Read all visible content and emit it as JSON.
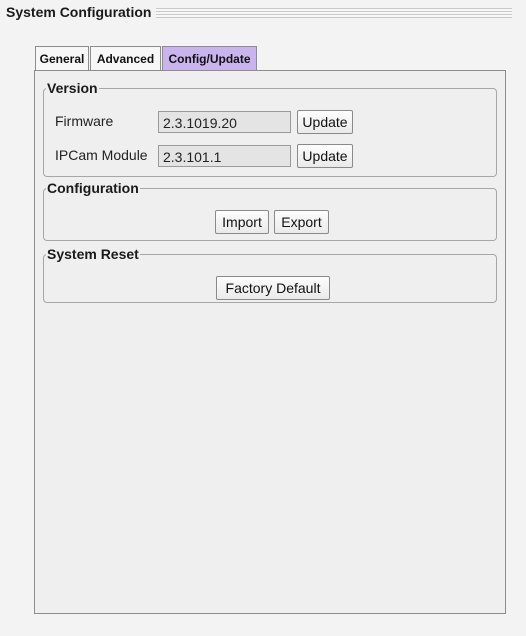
{
  "window": {
    "title": "System Configuration"
  },
  "tabs": [
    {
      "label": "General",
      "active": false
    },
    {
      "label": "Advanced",
      "active": false
    },
    {
      "label": "Config/Update",
      "active": true
    }
  ],
  "version": {
    "legend": "Version",
    "firmware_label": "Firmware",
    "firmware_value": "2.3.1019.20",
    "firmware_update": "Update",
    "ipcam_label": "IPCam Module",
    "ipcam_value": "2.3.101.1",
    "ipcam_update": "Update"
  },
  "configuration": {
    "legend": "Configuration",
    "import_label": "Import",
    "export_label": "Export"
  },
  "system_reset": {
    "legend": "System Reset",
    "factory_default_label": "Factory Default"
  },
  "colors": {
    "active_tab": "#c9b4ee",
    "background": "#f3f3f3"
  }
}
